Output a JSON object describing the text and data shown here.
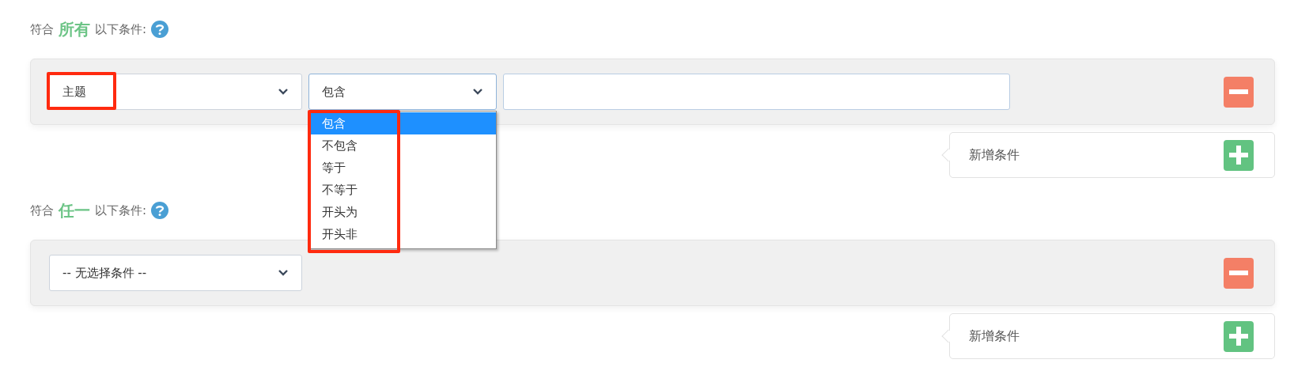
{
  "sections": [
    {
      "prefix": "符合",
      "quantifier": "所有",
      "suffix": "以下条件:",
      "conditions": [
        {
          "kind": "full",
          "field": {
            "value": "主题",
            "highlighted": true
          },
          "operator": {
            "value": "包含",
            "open": true,
            "highlighted": true,
            "options": [
              {
                "label": "包含",
                "selected": true
              },
              {
                "label": "不包含",
                "selected": false
              },
              {
                "label": "等于",
                "selected": false
              },
              {
                "label": "不等于",
                "selected": false
              },
              {
                "label": "开头为",
                "selected": false
              },
              {
                "label": "开头非",
                "selected": false
              }
            ]
          }
        }
      ],
      "add_label": "新增条件"
    },
    {
      "prefix": "符合",
      "quantifier": "任一",
      "suffix": "以下条件:",
      "conditions": [
        {
          "kind": "empty",
          "field": {
            "value": "-- 无选择条件 --",
            "highlighted": false
          }
        }
      ],
      "add_label": "新增条件"
    }
  ]
}
